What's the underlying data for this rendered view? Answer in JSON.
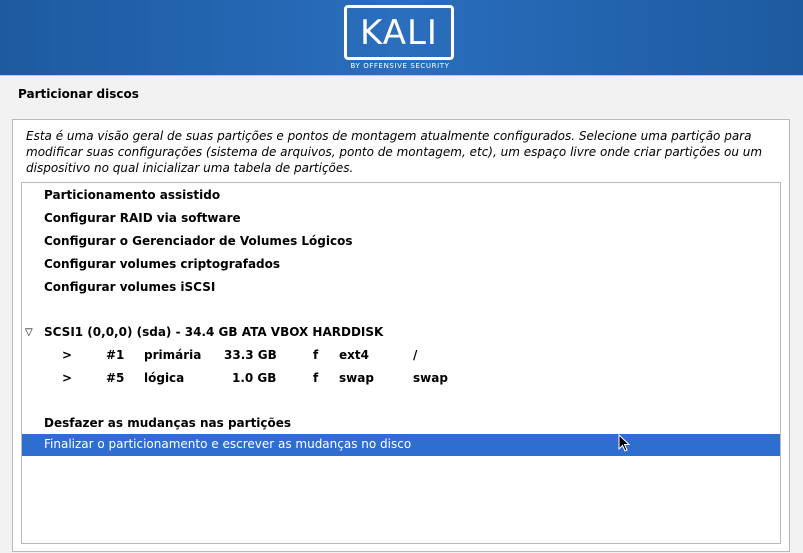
{
  "banner": {
    "logo_text": "KALI",
    "logo_subtitle": "BY OFFENSIVE SECURITY"
  },
  "page": {
    "title": "Particionar discos",
    "intro": "Esta é uma visão geral de suas partições e pontos de montagem atualmente configurados. Selecione uma partição para modificar suas configurações (sistema de arquivos, ponto de montagem, etc), um espaço livre onde criar partições ou um dispositivo no qual inicializar uma tabela de partições."
  },
  "menu": {
    "guided": "Particionamento assistido",
    "raid": "Configurar RAID via software",
    "lvm": "Configurar o Gerenciador de Volumes Lógicos",
    "crypto": "Configurar volumes criptografados",
    "iscsi": "Configurar volumes iSCSI",
    "undo": "Desfazer as mudanças nas partições",
    "finish": "Finalizar o particionamento e escrever as mudanças no disco"
  },
  "disk": {
    "label": "SCSI1 (0,0,0) (sda) - 34.4 GB ATA VBOX HARDDISK",
    "partitions": [
      {
        "arrow": ">",
        "num": "#1",
        "type": "primária",
        "size": "33.3 GB",
        "flag": "f",
        "fs": "ext4",
        "mount": "/"
      },
      {
        "arrow": ">",
        "num": "#5",
        "type": "lógica",
        "size": "1.0 GB",
        "flag": "f",
        "fs": "swap",
        "mount": "swap"
      }
    ]
  },
  "colors": {
    "banner": "#2a6ebd",
    "selection": "#2f6ed1"
  }
}
